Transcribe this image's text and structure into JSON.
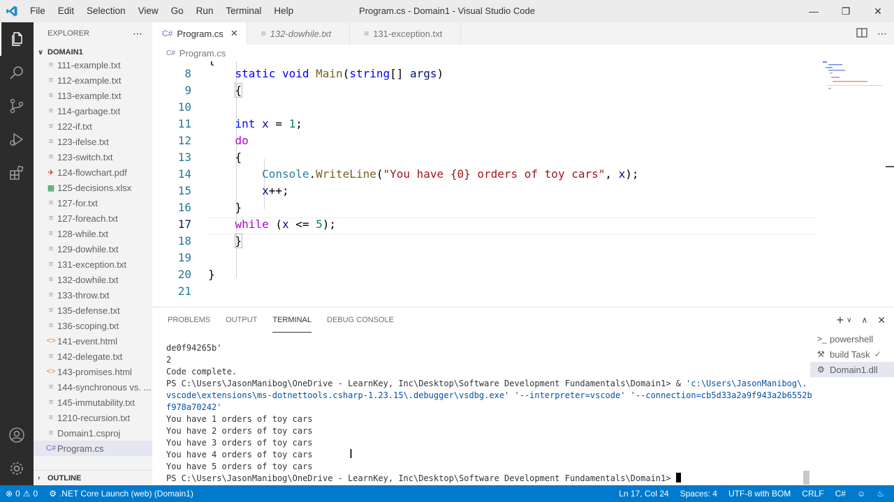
{
  "window": {
    "title": "Program.cs - Domain1 - Visual Studio Code",
    "menu": [
      "File",
      "Edit",
      "Selection",
      "View",
      "Go",
      "Run",
      "Terminal",
      "Help"
    ]
  },
  "sidebar": {
    "title": "EXPLORER",
    "folder": "DOMAIN1",
    "files": [
      {
        "name": "111-example.txt",
        "icon": "file-lines-icon"
      },
      {
        "name": "112-example.txt",
        "icon": "file-lines-icon"
      },
      {
        "name": "113-example.txt",
        "icon": "file-lines-icon"
      },
      {
        "name": "114-garbage.txt",
        "icon": "file-lines-icon"
      },
      {
        "name": "122-if.txt",
        "icon": "file-lines-icon"
      },
      {
        "name": "123-ifelse.txt",
        "icon": "file-lines-icon"
      },
      {
        "name": "123-switch.txt",
        "icon": "file-lines-icon"
      },
      {
        "name": "124-flowchart.pdf",
        "icon": "pdf-icon"
      },
      {
        "name": "125-decisions.xlsx",
        "icon": "excel-icon"
      },
      {
        "name": "127-for.txt",
        "icon": "file-lines-icon"
      },
      {
        "name": "127-foreach.txt",
        "icon": "file-lines-icon"
      },
      {
        "name": "128-while.txt",
        "icon": "file-lines-icon"
      },
      {
        "name": "129-dowhile.txt",
        "icon": "file-lines-icon"
      },
      {
        "name": "131-exception.txt",
        "icon": "file-lines-icon"
      },
      {
        "name": "132-dowhile.txt",
        "icon": "file-lines-icon"
      },
      {
        "name": "133-throw.txt",
        "icon": "file-lines-icon"
      },
      {
        "name": "135-defense.txt",
        "icon": "file-lines-icon"
      },
      {
        "name": "136-scoping.txt",
        "icon": "file-lines-icon"
      },
      {
        "name": "141-event.html",
        "icon": "html-icon"
      },
      {
        "name": "142-delegate.txt",
        "icon": "file-lines-icon"
      },
      {
        "name": "143-promises.html",
        "icon": "html-icon"
      },
      {
        "name": "144-synchronous vs. ...",
        "icon": "file-lines-icon"
      },
      {
        "name": "145-immutability.txt",
        "icon": "file-lines-icon"
      },
      {
        "name": "1210-recursion.txt",
        "icon": "file-lines-icon"
      },
      {
        "name": "Domain1.csproj",
        "icon": "csproj-icon"
      },
      {
        "name": "Program.cs",
        "icon": "csharp-icon",
        "active": true
      }
    ],
    "outline": "OUTLINE"
  },
  "tabs": [
    {
      "label": "Program.cs",
      "active": true,
      "italic": false
    },
    {
      "label": "132-dowhile.txt",
      "active": false,
      "italic": true
    },
    {
      "label": "131-exception.txt",
      "active": false,
      "italic": false
    }
  ],
  "breadcrumb": "Program.cs",
  "editor": {
    "current_line": 17,
    "line_numbers": [
      "8",
      "9",
      "10",
      "11",
      "12",
      "13",
      "14",
      "15",
      "16",
      "17",
      "18",
      "19",
      "20",
      "21"
    ]
  },
  "panel": {
    "tabs": [
      "PROBLEMS",
      "OUTPUT",
      "TERMINAL",
      "DEBUG CONSOLE"
    ],
    "active_tab": "TERMINAL",
    "terminal_lines": [
      "de0f94265b'",
      "2",
      "Code complete.",
      "PS C:\\Users\\JasonManibog\\OneDrive - LearnKey, Inc\\Desktop\\Software Development Fundamentals\\Domain1>",
      "You have 1 orders of toy cars",
      "You have 2 orders of toy cars",
      "You have 3 orders of toy cars",
      "You have 4 orders of toy cars",
      "You have 5 orders of toy cars",
      "PS C:\\Users\\JasonManibog\\OneDrive - LearnKey, Inc\\Desktop\\Software Development Fundamentals\\Domain1>"
    ],
    "command_amp": " & ",
    "command_path_1": "'c:\\Users\\JasonManibog\\.",
    "command_path_2": "vscode\\extensions\\ms-dotnettools.csharp-1.23.15\\.debugger\\vsdbg.exe' '--interpreter=vscode' '--connection=cb5d33a2a9f943a2b6552b",
    "command_path_3": "f978a70242'",
    "terminal_list": [
      {
        "label": "powershell",
        "active": false
      },
      {
        "label": "build Task",
        "active": false
      },
      {
        "label": "Domain1.dll",
        "active": true
      }
    ]
  },
  "statusbar": {
    "errors": "0",
    "warnings": "0",
    "launch": ".NET Core Launch (web) (Domain1)",
    "position": "Ln 17, Col 24",
    "spaces": "Spaces: 4",
    "encoding": "UTF-8 with BOM",
    "eol": "CRLF",
    "language": "C#"
  },
  "colors": {
    "accent": "#007acc",
    "activity_bar": "#2c2c2c",
    "sidebar": "#f3f3f3"
  }
}
